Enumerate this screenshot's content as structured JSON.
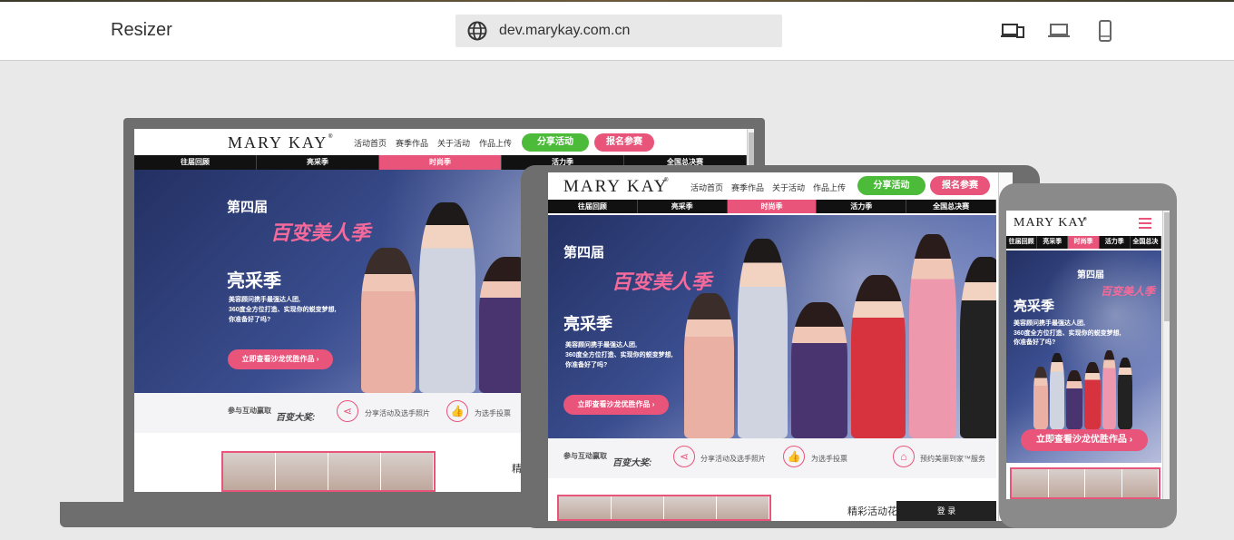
{
  "app": {
    "title": "Resizer"
  },
  "url": {
    "value": "dev.marykay.com.cn"
  },
  "devices": {
    "all": "all-devices-icon",
    "laptop": "laptop-icon",
    "phone": "phone-icon"
  },
  "site": {
    "logo": "MARY KAY",
    "logo_reg": "®",
    "nav": [
      "活动首页",
      "赛季作品",
      "关于活动",
      "作品上传"
    ],
    "share": "分享活动",
    "join": "报名参赛",
    "tabs": [
      "往届回顾",
      "亮采季",
      "时尚季",
      "活力季",
      "全国总决赛"
    ],
    "edition": "第四届",
    "badge": "百变美人季",
    "season": "亮采季",
    "desc1": "美容顾问携手最强达人团,",
    "desc2": "360度全方位打造、实现你的蜕变梦想,",
    "desc3": "你准备好了吗?",
    "cta": "立即查看沙龙优胜作品",
    "strip_label": "参与互动赢取",
    "strip_prize": "百变大奖:",
    "strip_item1": "分享活动及选手照片",
    "strip_item2": "为选手投票",
    "strip_item3": "预约美丽到家™服务",
    "section_title": "精彩活动花絮",
    "login": "登 录"
  },
  "colors": {
    "pink": "#e8547a",
    "green": "#4cbb3a",
    "frame": "#6e6e6e"
  }
}
